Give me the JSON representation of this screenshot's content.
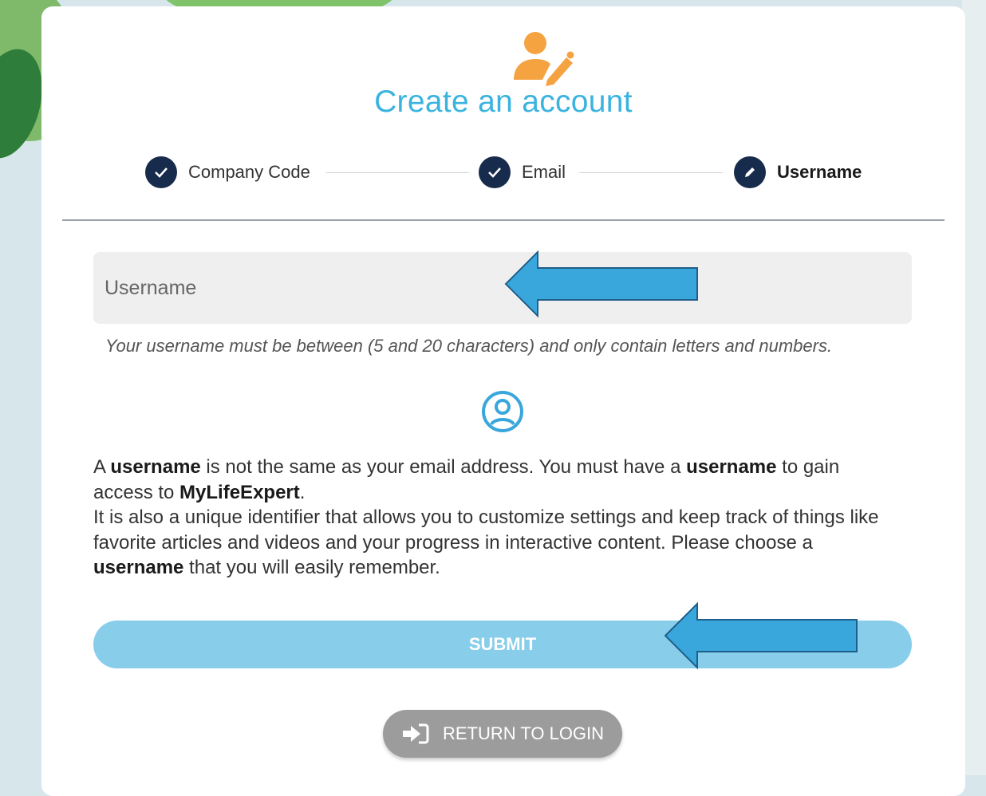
{
  "page": {
    "title": "Create an account"
  },
  "stepper": {
    "steps": [
      {
        "label": "Company Code",
        "state": "done"
      },
      {
        "label": "Email",
        "state": "done"
      },
      {
        "label": "Username",
        "state": "current"
      }
    ]
  },
  "form": {
    "username_placeholder": "Username",
    "username_value": "",
    "hint": "Your username must be between (5 and 20 characters) and only contain letters and numbers.",
    "submit_label": "SUBMIT"
  },
  "info": {
    "p1_a": "A ",
    "p1_b": "username",
    "p1_c": " is not the same as your email address. You must have a ",
    "p1_d": "username",
    "p1_e": " to gain access to ",
    "p1_f": "MyLifeExpert",
    "p1_g": ".",
    "p2_a": "It is also a unique identifier that allows you to customize settings and keep track of things like favorite articles and videos and your progress in interactive content. Please choose a ",
    "p2_b": "username",
    "p2_c": " that you will easily remember."
  },
  "return_button": {
    "label": "RETURN TO LOGIN"
  },
  "colors": {
    "accent": "#3ab3df",
    "step_circle": "#172b4d",
    "submit_bg": "#88cdea",
    "return_bg": "#9c9c9c",
    "icon_orange": "#f4a340",
    "annotation_arrow": "#3aa7dc"
  },
  "icons": [
    "user-edit-icon",
    "check-icon",
    "pencil-icon",
    "user-circle-icon",
    "sign-in-icon",
    "annotation-arrow-icon"
  ]
}
